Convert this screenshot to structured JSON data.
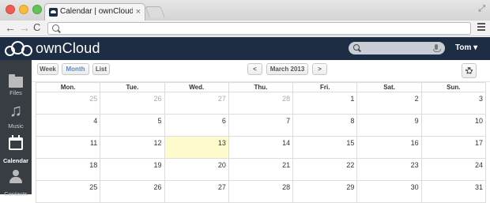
{
  "browser": {
    "tab_title": "Calendar | ownCloud (Tom)",
    "tab_close": "×",
    "address": "",
    "nav_back": "←",
    "nav_forward": "→",
    "nav_reload": "C"
  },
  "header": {
    "logo_text": "ownCloud",
    "search_placeholder": "",
    "user_label": "Tom ▾"
  },
  "sidebar": {
    "items": [
      {
        "label": "Files",
        "icon": "folder-icon"
      },
      {
        "label": "Music",
        "icon": "music-note-icon"
      },
      {
        "label": "Calendar",
        "icon": "calendar-icon",
        "active": true
      },
      {
        "label": "Contacts",
        "icon": "contacts-icon"
      }
    ]
  },
  "controls": {
    "views": [
      "Week",
      "Month",
      "List"
    ],
    "selected_view": "Month",
    "prev": "<",
    "next": ">",
    "current_period": "March 2013",
    "settings_icon": "gear-icon"
  },
  "calendar": {
    "weekdays": [
      "Mon.",
      "Tue.",
      "Wed.",
      "Thu.",
      "Fri.",
      "Sat.",
      "Sun."
    ],
    "weeks": [
      [
        "25",
        "26",
        "27",
        "28",
        "1",
        "2",
        "3"
      ],
      [
        "4",
        "5",
        "6",
        "7",
        "8",
        "9",
        "10"
      ],
      [
        "11",
        "12",
        "13",
        "14",
        "15",
        "16",
        "17"
      ],
      [
        "18",
        "19",
        "20",
        "21",
        "22",
        "23",
        "24"
      ],
      [
        "25",
        "26",
        "27",
        "28",
        "29",
        "30",
        "31"
      ]
    ],
    "today": "13",
    "today_color": "#fefccd"
  }
}
